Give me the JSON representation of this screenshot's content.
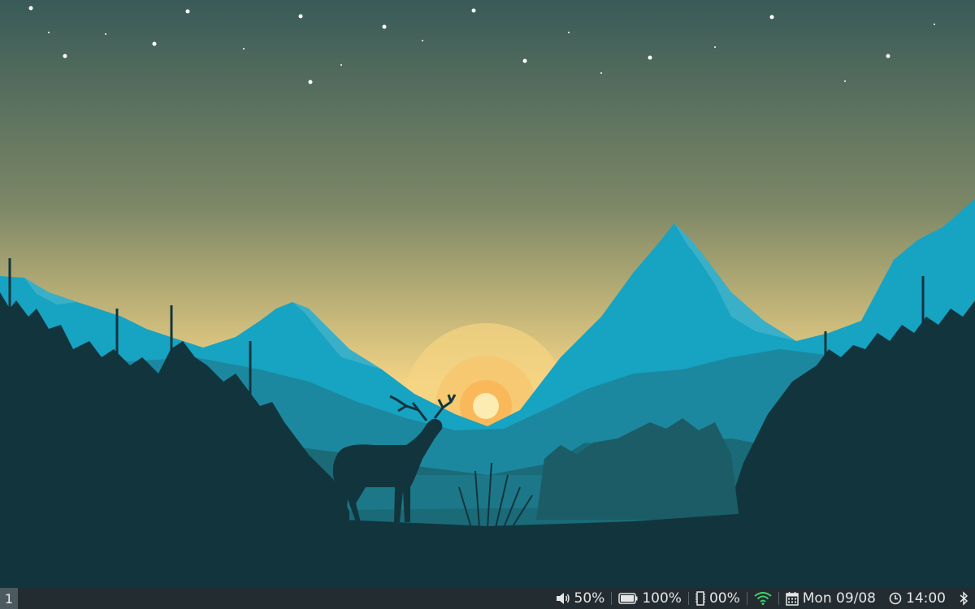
{
  "wallpaper": {
    "sky_top": "#395a58",
    "sky_bottom": "#f1d385",
    "sun": "#fdecb2",
    "mountain_far": "#17a3c2",
    "mountain_light": "#3ab0c8",
    "mountain_mid": "#1b88a0",
    "hills": "#1a6a78",
    "foreground": "#12353d"
  },
  "taskbar": {
    "background": "#232c30",
    "workspace": {
      "label": "1"
    },
    "tray": {
      "volume": {
        "icon": "speaker-icon",
        "value": "50%"
      },
      "battery": {
        "icon": "battery-icon",
        "value": "100%"
      },
      "memory": {
        "icon": "memory-chip-icon",
        "value": "00%"
      },
      "wifi": {
        "icon": "wifi-icon",
        "color": "#3fd06a"
      },
      "date": {
        "icon": "calendar-icon",
        "value": "Mon 09/08"
      },
      "time": {
        "icon": "clock-icon",
        "value": "14:00"
      },
      "bluetooth": {
        "icon": "bluetooth-icon"
      }
    }
  }
}
